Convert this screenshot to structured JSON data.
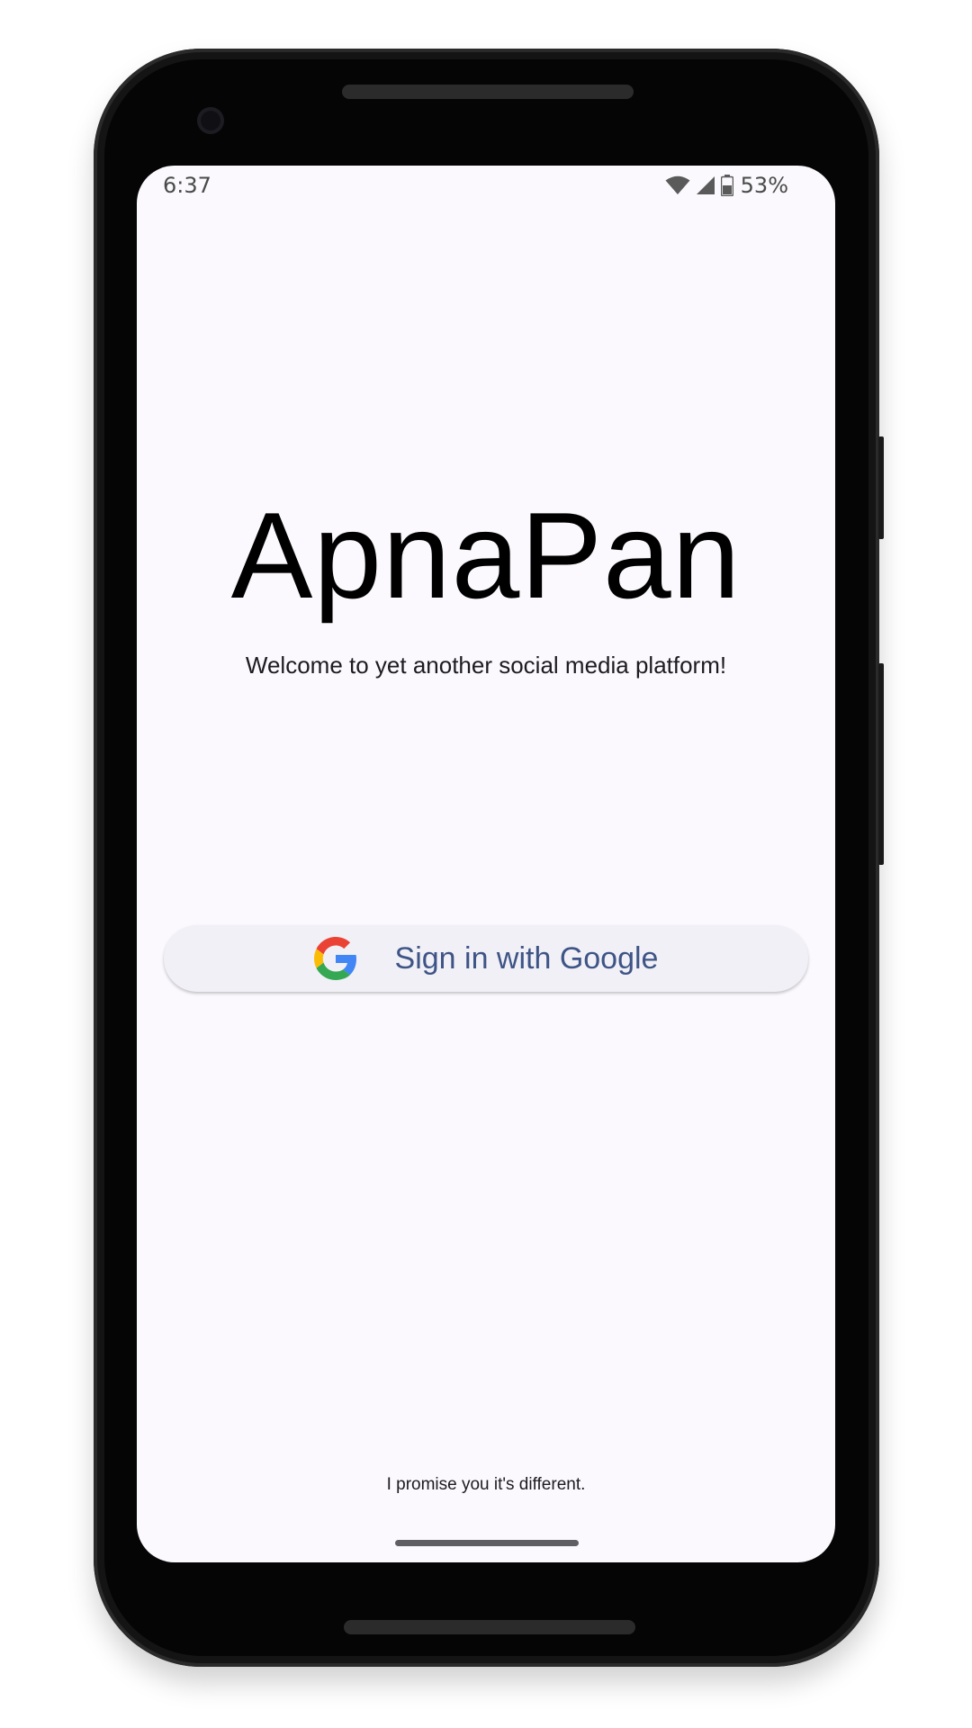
{
  "status_bar": {
    "time": "6:37",
    "battery_percent": "53%",
    "icons": [
      "wifi-icon",
      "cell-signal-icon",
      "battery-icon"
    ]
  },
  "app": {
    "title": "ApnaPan",
    "subtitle": "Welcome to yet another social media platform!",
    "footer": "I promise you it's different."
  },
  "sign_in": {
    "label": "Sign in with Google",
    "icon": "google-logo-icon",
    "text_color": "#3e5486",
    "background_color": "#f1f0f6"
  },
  "colors": {
    "screen_background": "#fbf9fd",
    "title": "#000000"
  }
}
